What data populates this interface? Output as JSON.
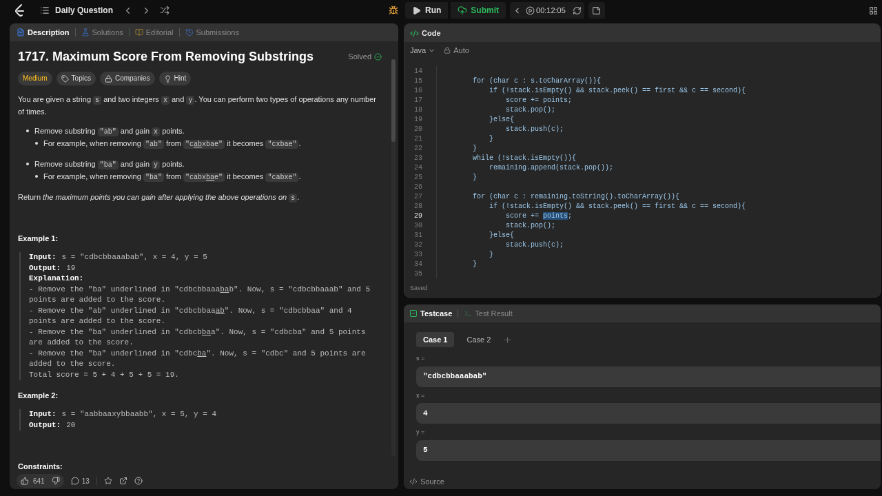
{
  "topbar": {
    "title": "Daily Question",
    "run": "Run",
    "submit": "Submit",
    "timer": "00:12:05"
  },
  "left_tabs": [
    {
      "label": "Description",
      "selected": true,
      "kind": "description"
    },
    {
      "label": "Solutions",
      "selected": false,
      "kind": "solutions"
    },
    {
      "label": "Editorial",
      "selected": false,
      "kind": "editorial"
    },
    {
      "label": "Submissions",
      "selected": false,
      "kind": "submissions"
    }
  ],
  "problem": {
    "title": "1717. Maximum Score From Removing Substrings",
    "status": "Solved",
    "tags": [
      {
        "label": "Medium",
        "kind": "difficulty"
      },
      {
        "label": "Topics",
        "kind": "topics"
      },
      {
        "label": "Companies",
        "kind": "companies"
      },
      {
        "label": "Hint",
        "kind": "hint"
      }
    ],
    "blocks": [
      {
        "kind": "para",
        "runs": [
          {
            "kind": "text",
            "text": "You are given a string "
          },
          {
            "kind": "code",
            "text": "s"
          },
          {
            "kind": "text",
            "text": " and two integers "
          },
          {
            "kind": "code",
            "text": "x"
          },
          {
            "kind": "text",
            "text": " and "
          },
          {
            "kind": "code",
            "text": "y"
          },
          {
            "kind": "text",
            "text": ". You can perform two types of operations any number of times."
          }
        ]
      },
      {
        "kind": "bullet",
        "runs": [
          {
            "kind": "text",
            "text": "Remove substring "
          },
          {
            "kind": "code",
            "text": "\"ab\""
          },
          {
            "kind": "text",
            "text": " and gain "
          },
          {
            "kind": "code",
            "text": "x"
          },
          {
            "kind": "text",
            "text": " points."
          }
        ]
      },
      {
        "kind": "subbullet",
        "runs": [
          {
            "kind": "text",
            "text": "For example, when removing "
          },
          {
            "kind": "code",
            "text": "\"ab\""
          },
          {
            "kind": "text",
            "text": " from "
          },
          {
            "kind": "code_parts",
            "parts": [
              {
                "text": "\"c",
                "underlined": false
              },
              {
                "text": "ab",
                "underlined": true
              },
              {
                "text": "xbae\"",
                "underlined": false
              }
            ]
          },
          {
            "kind": "text",
            "text": " it becomes "
          },
          {
            "kind": "code",
            "text": "\"cxbae\""
          },
          {
            "kind": "text",
            "text": "."
          }
        ]
      },
      {
        "kind": "bullet",
        "runs": [
          {
            "kind": "text",
            "text": "Remove substring "
          },
          {
            "kind": "code",
            "text": "\"ba\""
          },
          {
            "kind": "text",
            "text": " and gain "
          },
          {
            "kind": "code",
            "text": "y"
          },
          {
            "kind": "text",
            "text": " points."
          }
        ]
      },
      {
        "kind": "subbullet",
        "runs": [
          {
            "kind": "text",
            "text": "For example, when removing "
          },
          {
            "kind": "code",
            "text": "\"ba\""
          },
          {
            "kind": "text",
            "text": " from "
          },
          {
            "kind": "code_parts",
            "parts": [
              {
                "text": "\"cabx",
                "underlined": false
              },
              {
                "text": "ba",
                "underlined": true
              },
              {
                "text": "e\"",
                "underlined": false
              }
            ]
          },
          {
            "kind": "text",
            "text": " it becomes "
          },
          {
            "kind": "code",
            "text": "\"cabxe\""
          },
          {
            "kind": "text",
            "text": "."
          }
        ]
      },
      {
        "kind": "para",
        "runs": [
          {
            "kind": "text",
            "text": "Return *the maximum points you can gain after applying the above operations on* "
          },
          {
            "kind": "code",
            "text": "s"
          },
          {
            "kind": "text",
            "text": "."
          }
        ]
      }
    ],
    "examples": [
      {
        "title": "Example 1:",
        "lines": [
          {
            "kind": "field",
            "label": "Input:",
            "value": "s = \"cdbcbbaaabab\", x = 4, y = 5"
          },
          {
            "kind": "field",
            "label": "Output:",
            "value": "19"
          },
          {
            "kind": "heading",
            "label": "Explanation:"
          },
          {
            "kind": "text",
            "parts": [
              {
                "text": "- Remove the \"ba\" underlined in \"cdbcbbaaa",
                "underlined": false
              },
              {
                "text": "ba",
                "underlined": true
              },
              {
                "text": "b\". Now, s = \"cdbcbbaaab\" and 5 points are added to the score.",
                "underlined": false
              }
            ]
          },
          {
            "kind": "text",
            "parts": [
              {
                "text": "- Remove the \"ab\" underlined in \"cdbcbbaa",
                "underlined": false
              },
              {
                "text": "ab",
                "underlined": true
              },
              {
                "text": "\". Now, s = \"cdbcbbaa\" and 4 points are added to the score.",
                "underlined": false
              }
            ]
          },
          {
            "kind": "text",
            "parts": [
              {
                "text": "- Remove the \"ba\" underlined in \"cdbcb",
                "underlined": false
              },
              {
                "text": "ba",
                "underlined": true
              },
              {
                "text": "a\". Now, s = \"cdbcba\" and 5 points are added to the score.",
                "underlined": false
              }
            ]
          },
          {
            "kind": "text",
            "parts": [
              {
                "text": "- Remove the \"ba\" underlined in \"cdbc",
                "underlined": false
              },
              {
                "text": "ba",
                "underlined": true
              },
              {
                "text": "\". Now, s = \"cdbc\" and 5 points are added to the score.",
                "underlined": false
              }
            ]
          },
          {
            "kind": "text",
            "parts": [
              {
                "text": "Total score = 5 + 4 + 5 + 5 = 19.",
                "underlined": false
              }
            ]
          }
        ]
      },
      {
        "title": "Example 2:",
        "lines": [
          {
            "kind": "field",
            "label": "Input:",
            "value": "s = \"aabbaaxybbaabb\", x = 5, y = 4"
          },
          {
            "kind": "field",
            "label": "Output:",
            "value": "20"
          }
        ]
      }
    ],
    "constraints_title": "Constraints:"
  },
  "footer": {
    "likes": "641",
    "comments": "13"
  },
  "editor": {
    "tab": "Code",
    "language": "Java",
    "mode": "Auto",
    "status": "Saved",
    "lines": [
      {
        "number": "14",
        "kind": "blank"
      },
      {
        "number": "15",
        "kind": "plain",
        "text": "        for (char c : s.toCharArray()){"
      },
      {
        "number": "16",
        "kind": "plain",
        "text": "            if (!stack.isEmpty() && stack.peek() == first && c == second){"
      },
      {
        "number": "17",
        "kind": "plain",
        "text": "                score += points;"
      },
      {
        "number": "18",
        "kind": "plain",
        "text": "                stack.pop();"
      },
      {
        "number": "19",
        "kind": "plain",
        "text": "            }else{"
      },
      {
        "number": "20",
        "kind": "plain",
        "text": "                stack.push(c);"
      },
      {
        "number": "21",
        "kind": "plain",
        "text": "            }"
      },
      {
        "number": "22",
        "kind": "plain",
        "text": "        }"
      },
      {
        "number": "23",
        "kind": "plain",
        "text": "        while (!stack.isEmpty()){"
      },
      {
        "number": "24",
        "kind": "plain",
        "text": "            remaining.append(stack.pop());"
      },
      {
        "number": "25",
        "kind": "plain",
        "text": "        }"
      },
      {
        "number": "26",
        "kind": "blank"
      },
      {
        "number": "27",
        "kind": "plain",
        "text": "        for (char c : remaining.toString().toCharArray()){"
      },
      {
        "number": "28",
        "kind": "plain",
        "text": "            if (!stack.isEmpty() && stack.peek() == first && c == second){"
      },
      {
        "number": "29",
        "kind": "selection",
        "current": true,
        "before": "                score += ",
        "selected": "points",
        "after": ";"
      },
      {
        "number": "30",
        "kind": "plain",
        "text": "                stack.pop();"
      },
      {
        "number": "31",
        "kind": "plain",
        "text": "            }else{"
      },
      {
        "number": "32",
        "kind": "plain",
        "text": "                stack.push(c);"
      },
      {
        "number": "33",
        "kind": "plain",
        "text": "            }"
      },
      {
        "number": "34",
        "kind": "plain",
        "text": "        }"
      },
      {
        "number": "35",
        "kind": "blank"
      }
    ]
  },
  "testcase": {
    "tabs": [
      {
        "label": "Testcase",
        "selected": true,
        "kind": "testcase"
      },
      {
        "label": "Test Result",
        "selected": false,
        "kind": "result"
      }
    ],
    "cases": [
      {
        "label": "Case 1",
        "selected": true
      },
      {
        "label": "Case 2",
        "selected": false
      }
    ],
    "inputs": [
      {
        "name": "s =",
        "value": "\"cdbcbbaaabab\""
      },
      {
        "name": "x =",
        "value": "4"
      },
      {
        "name": "y =",
        "value": "5"
      }
    ],
    "source": "Source"
  }
}
